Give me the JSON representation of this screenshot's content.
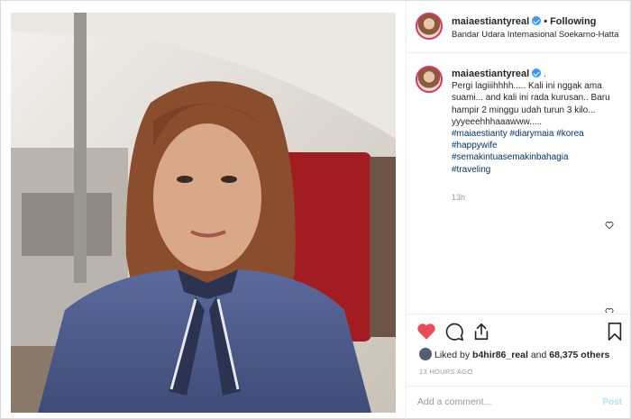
{
  "header": {
    "username": "maiaestiantyreal",
    "separator": "•",
    "follow_status": "Following",
    "location": "Bandar Udara Internasional Soekarno-Hatta"
  },
  "caption": {
    "username": "maiaestiantyreal",
    "trailing": ".",
    "text": "Pergi lagiiihhhh..... Kali ini nggak ama suami... and kali ini rada kurusan.. Baru hampir 2 minggu udah turun 3 kilo... yyyeeehhhaaawww.....",
    "hashtags": [
      "#maiaestianty #diarymaia #korea",
      "#happywife",
      "#semakintuasemakinbahagia",
      "#traveling"
    ],
    "time": "13h"
  },
  "actions": {
    "like_icon": "heart-filled-icon",
    "comment_icon": "comment-icon",
    "share_icon": "share-icon",
    "save_icon": "bookmark-icon"
  },
  "likes": {
    "prefix": "Liked by ",
    "user": "b4hir86_real",
    "middle": " and ",
    "count": "68,375 others"
  },
  "posted_ago": "13 HOURS AGO",
  "comment": {
    "placeholder": "Add a comment...",
    "post_label": "Post"
  },
  "colors": {
    "like": "#ed4956",
    "link": "#003569",
    "verified": "#3897f0",
    "post_disabled": "#b2dffc"
  }
}
